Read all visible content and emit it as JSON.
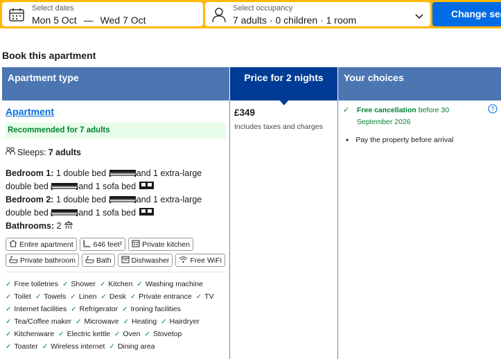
{
  "search": {
    "dates_label": "Select dates",
    "check_in": "Mon 5 Oct",
    "separator": "—",
    "check_out": "Wed 7 Oct",
    "occupancy_label": "Select occupancy",
    "occupancy_value": "7 adults · 0 children · 1 room",
    "change_button": "Change search"
  },
  "section_title": "Book this apartment",
  "table": {
    "headers": {
      "type": "Apartment type",
      "price": "Price for 2 nights",
      "choices": "Your choices"
    }
  },
  "room": {
    "name": "Apartment",
    "badge": "Recommended for 7 adults",
    "sleeps_label": "Sleeps:",
    "sleeps_value": "7 adults",
    "bedroom1_label": "Bedroom 1:",
    "bedroom1_a": "1 double bed",
    "bedroom1_b": "and 1 extra-large",
    "bedroom1_c": "double bed",
    "bedroom1_d": "and 1 sofa bed",
    "bedroom2_label": "Bedroom 2:",
    "bedroom2_a": "1 double bed",
    "bedroom2_b": "and 1 extra-large",
    "bedroom2_c": "double bed",
    "bedroom2_d": "and 1 sofa bed",
    "bathrooms_label": "Bathrooms:",
    "bathrooms_value": "2",
    "chips": [
      {
        "label": "Entire apartment",
        "icon": "house-icon"
      },
      {
        "label": "646 feet²",
        "icon": "ruler-icon"
      },
      {
        "label": "Private kitchen",
        "icon": "kitchen-icon"
      },
      {
        "label": "Private bathroom",
        "icon": "bathtub-icon"
      },
      {
        "label": "Bath",
        "icon": "bathtub-icon"
      },
      {
        "label": "Dishwasher",
        "icon": "dishwasher-icon"
      },
      {
        "label": "Free WiFi",
        "icon": "wifi-icon"
      }
    ],
    "amenities": [
      [
        "Free toiletries",
        "Shower",
        "Kitchen",
        "Washing machine"
      ],
      [
        "Toilet",
        "Towels",
        "Linen",
        "Desk",
        "Private entrance",
        "TV"
      ],
      [
        "Internet facilities",
        "Refrigerator",
        "Ironing facilities"
      ],
      [
        "Tea/Coffee maker",
        "Microwave",
        "Heating",
        "Hairdryer"
      ],
      [
        "Kitchenware",
        "Electric kettle",
        "Oven",
        "Stovetop"
      ],
      [
        "Toaster",
        "Wireless internet",
        "Dining area"
      ]
    ]
  },
  "price": {
    "value": "£349",
    "note": "Includes taxes and charges"
  },
  "choices": {
    "free_cancel": "Free cancellation",
    "free_cancel_rest": "before 30 September 2026",
    "pay": "Pay the property before arrival"
  },
  "colors": {
    "brand_yellow": "#ffb700",
    "brand_blue": "#006ce4",
    "header_blue": "#4c76b2",
    "header_dark": "#003b95",
    "green": "#008234"
  }
}
